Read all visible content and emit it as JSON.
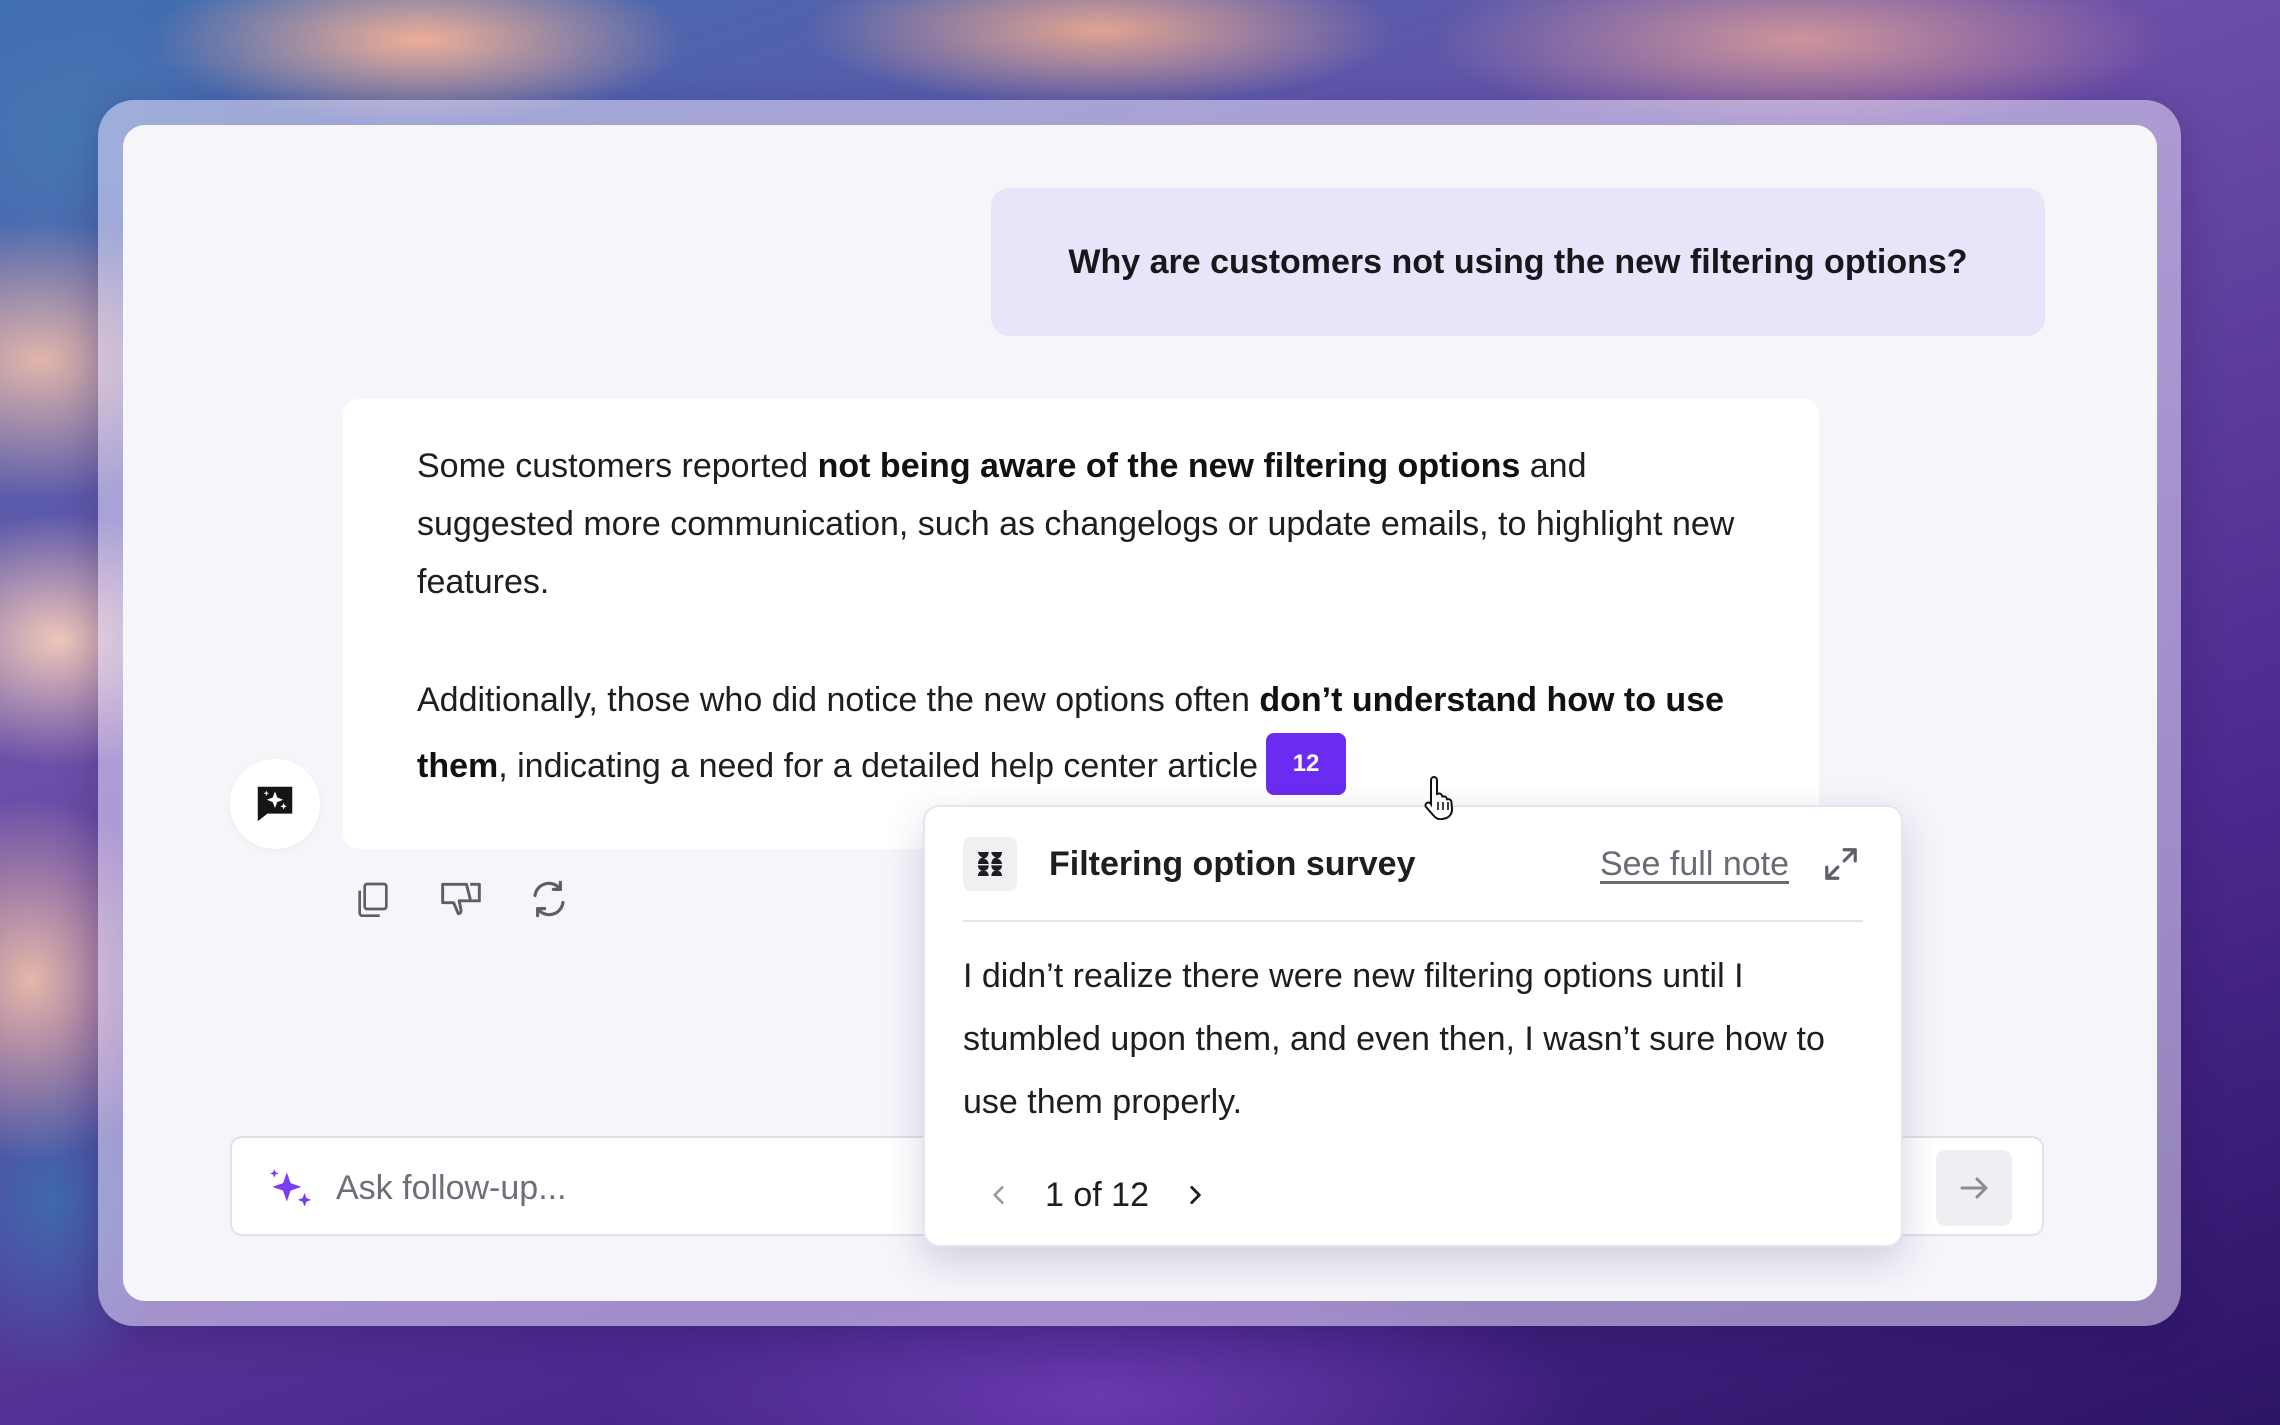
{
  "conversation": {
    "user_question": "Why are customers not using the new filtering options?",
    "answer": {
      "p1_pre": "Some customers reported ",
      "p1_bold": "not being aware of the new filtering options",
      "p1_post": " and suggested more communication, such as changelogs or update emails, to highlight new features.",
      "p2_pre": "Additionally, those who did notice the new options often ",
      "p2_bold": "don’t understand how to use them",
      "p2_post": ", indicating a need for a detailed help center article",
      "citation_count": "12"
    },
    "actions": [
      {
        "name": "copy-icon"
      },
      {
        "name": "thumbs-down-icon"
      },
      {
        "name": "regenerate-icon"
      }
    ]
  },
  "popover": {
    "source_icon": "source-logo-icon",
    "title": "Filtering option survey",
    "see_full_note": "See full note",
    "quote": "I didn’t realize there were new filtering options until I stumbled upon them, and even then, I wasn’t sure how to use them properly.",
    "pager": "1 of 12"
  },
  "composer": {
    "placeholder": "Ask follow-up...",
    "value": ""
  },
  "colors": {
    "accent": "#6a2cf0",
    "user_bubble": "#e9e4fa",
    "window_bg": "#f6f5fa",
    "sparkle": "#7a3cf5"
  }
}
